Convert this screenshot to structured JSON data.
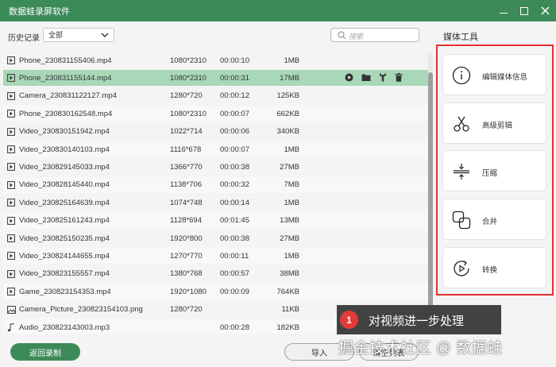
{
  "window": {
    "title": "数据蛙录屏软件"
  },
  "toolbar": {
    "history_label": "历史记录",
    "filter_value": "全部",
    "search_placeholder": "搜索"
  },
  "files": [
    {
      "name": "Phone_230831155406.mp4",
      "resolution": "1080*2310",
      "duration": "00:00:10",
      "size": "1MB",
      "icon": "video-file-icon"
    },
    {
      "name": "Phone_230831155144.mp4",
      "resolution": "1080*2310",
      "duration": "00:00:31",
      "size": "17MB",
      "icon": "video-file-icon",
      "selected": true
    },
    {
      "name": "Camera_230831122127.mp4",
      "resolution": "1280*720",
      "duration": "00:00:12",
      "size": "125KB",
      "icon": "video-file-icon"
    },
    {
      "name": "Phone_230830162548.mp4",
      "resolution": "1080*2310",
      "duration": "00:00:07",
      "size": "662KB",
      "icon": "video-file-icon"
    },
    {
      "name": "Video_230830151942.mp4",
      "resolution": "1022*714",
      "duration": "00:00:06",
      "size": "340KB",
      "icon": "video-file-icon"
    },
    {
      "name": "Video_230830140103.mp4",
      "resolution": "1116*678",
      "duration": "00:00:07",
      "size": "1MB",
      "icon": "video-file-icon"
    },
    {
      "name": "Video_230829145033.mp4",
      "resolution": "1366*770",
      "duration": "00:00:38",
      "size": "27MB",
      "icon": "video-file-icon"
    },
    {
      "name": "Video_230828145440.mp4",
      "resolution": "1138*706",
      "duration": "00:00:32",
      "size": "7MB",
      "icon": "video-file-icon"
    },
    {
      "name": "Video_230825164639.mp4",
      "resolution": "1074*748",
      "duration": "00:00:14",
      "size": "1MB",
      "icon": "video-file-icon"
    },
    {
      "name": "Video_230825161243.mp4",
      "resolution": "1128*694",
      "duration": "00:01:45",
      "size": "13MB",
      "icon": "video-file-icon"
    },
    {
      "name": "Video_230825150235.mp4",
      "resolution": "1920*800",
      "duration": "00:00:38",
      "size": "27MB",
      "icon": "video-file-icon"
    },
    {
      "name": "Video_230824144655.mp4",
      "resolution": "1270*770",
      "duration": "00:00:11",
      "size": "1MB",
      "icon": "video-file-icon"
    },
    {
      "name": "Video_230823155557.mp4",
      "resolution": "1380*768",
      "duration": "00:00:57",
      "size": "38MB",
      "icon": "video-file-icon"
    },
    {
      "name": "Game_230823154353.mp4",
      "resolution": "1920*1080",
      "duration": "00:00:09",
      "size": "764KB",
      "icon": "video-file-icon"
    },
    {
      "name": "Camera_Picture_230823154103.png",
      "resolution": "1280*720",
      "duration": "",
      "size": "11KB",
      "icon": "image-file-icon"
    },
    {
      "name": "Audio_230823143003.mp3",
      "resolution": "",
      "duration": "00:00:28",
      "size": "182KB",
      "icon": "audio-file-icon"
    }
  ],
  "bottom": {
    "back_label": "返回录制",
    "import_label": "导入",
    "clear_label": "清空列表"
  },
  "media_tools": {
    "title": "媒体工具",
    "items": [
      {
        "label": "编辑媒体信息",
        "icon": "info-icon"
      },
      {
        "label": "高级剪辑",
        "icon": "scissors-icon"
      },
      {
        "label": "压缩",
        "icon": "compress-icon"
      },
      {
        "label": "合并",
        "icon": "merge-icon"
      },
      {
        "label": "转换",
        "icon": "convert-icon"
      }
    ]
  },
  "annotation": {
    "number": "1",
    "text": "对视频进一步处理"
  },
  "watermark": "掘金技术社区 @ 数据蛙",
  "colors": {
    "brand_green": "#3c8a58",
    "selected_row": "#a9d8b8",
    "highlight_red": "#e23030"
  }
}
